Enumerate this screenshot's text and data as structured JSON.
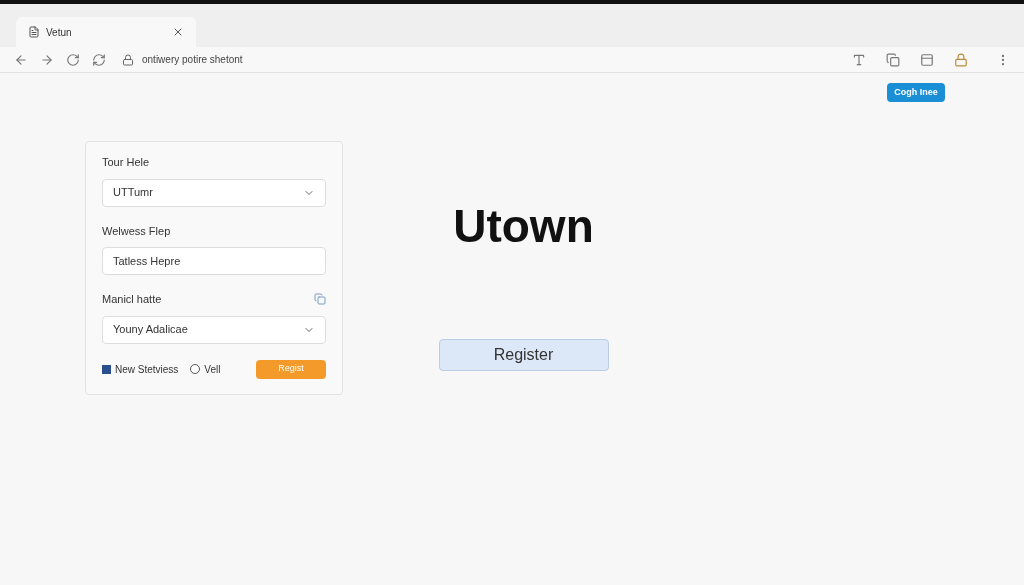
{
  "browser": {
    "tab": {
      "title": "Vetun"
    },
    "address": "ontiwery potire shetont"
  },
  "header_button": "Cogh Inee",
  "form": {
    "fields": [
      {
        "kind": "select",
        "label": "Tour Hele",
        "value": "UTTumr"
      },
      {
        "kind": "text",
        "label": "Welwess Flep",
        "value": "Tatless Hepre"
      },
      {
        "kind": "select",
        "label": "Manicl hatte",
        "value": "Youny Adalicae",
        "label_icon": true
      }
    ],
    "options": [
      {
        "kind": "checkbox",
        "label": "New Stetviess",
        "checked": true
      },
      {
        "kind": "radio",
        "label": "Vell",
        "checked": false
      }
    ],
    "submit": "Regist"
  },
  "title": "Utown",
  "register_button": "Register"
}
